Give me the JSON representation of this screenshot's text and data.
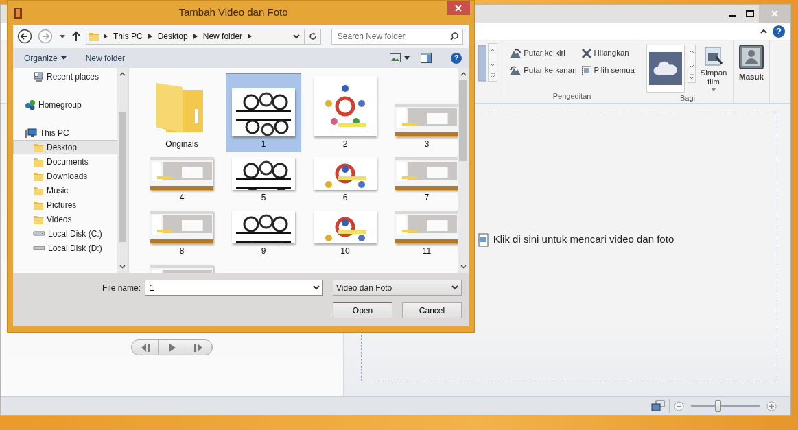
{
  "app": {
    "help": "?",
    "ribbon": {
      "edit_group": {
        "label": "Pengeditan",
        "commands": [
          {
            "label": "Putar ke kiri",
            "kind": "rotate-left"
          },
          {
            "label": "Hilangkan",
            "kind": "remove"
          },
          {
            "label": "Putar ke kanan",
            "kind": "rotate-right"
          },
          {
            "label": "Pilih semua",
            "kind": "select-all"
          }
        ]
      },
      "share_group": {
        "label": "Bagi",
        "save": {
          "label": "Simpan film",
          "dropdown": true
        }
      },
      "sign_in": {
        "label": "Masuk"
      }
    },
    "storyboard_hint": "Klik di sini untuk mencari video dan foto",
    "zoom": {
      "level": 0.39
    }
  },
  "dialog": {
    "title": "Tambah Video dan Foto",
    "breadcrumb": [
      "This PC",
      "Desktop",
      "New folder"
    ],
    "search": {
      "placeholder": "Search New folder"
    },
    "help": "?",
    "toolbar": [
      {
        "label": "Organize",
        "dropdown": true
      },
      {
        "label": "New folder",
        "dropdown": false
      }
    ],
    "sidebar": {
      "favorites": [
        {
          "label": "Recent places",
          "kind": "recent",
          "selected": false
        }
      ],
      "items": [
        {
          "label": "Homegroup",
          "kind": "homegroup",
          "selected": false
        },
        {
          "label": "This PC",
          "kind": "pc",
          "selected": false,
          "children": [
            {
              "label": "Desktop",
              "kind": "folder",
              "selected": true
            },
            {
              "label": "Documents",
              "kind": "folder",
              "selected": false
            },
            {
              "label": "Downloads",
              "kind": "folder",
              "selected": false
            },
            {
              "label": "Music",
              "kind": "folder",
              "selected": false
            },
            {
              "label": "Pictures",
              "kind": "folder",
              "selected": false
            },
            {
              "label": "Videos",
              "kind": "folder",
              "selected": false
            },
            {
              "label": "Local Disk (C:)",
              "kind": "drive",
              "selected": false
            },
            {
              "label": "Local Disk (D:)",
              "kind": "drive",
              "selected": false
            }
          ]
        }
      ]
    },
    "files": [
      {
        "label": "Originals",
        "kind": "folder",
        "selected": false
      },
      {
        "label": "1",
        "kind": "picture",
        "selected": true
      },
      {
        "label": "2",
        "kind": "picture",
        "selected": false
      },
      {
        "label": "3",
        "kind": "picture",
        "selected": false
      },
      {
        "label": "4",
        "kind": "picture",
        "selected": false
      },
      {
        "label": "5",
        "kind": "picture",
        "selected": false
      },
      {
        "label": "6",
        "kind": "picture",
        "selected": false
      },
      {
        "label": "7",
        "kind": "picture",
        "selected": false
      },
      {
        "label": "8",
        "kind": "picture",
        "selected": false
      },
      {
        "label": "9",
        "kind": "picture",
        "selected": false
      },
      {
        "label": "10",
        "kind": "picture",
        "selected": false
      },
      {
        "label": "11",
        "kind": "picture",
        "selected": false
      },
      {
        "kind": "picture",
        "selected": false
      }
    ],
    "file_name": {
      "label": "File name:",
      "value": "1"
    },
    "file_type": "Video dan Foto",
    "buttons": [
      {
        "label": "Open",
        "default": true
      },
      {
        "label": "Cancel",
        "default": false
      }
    ]
  }
}
